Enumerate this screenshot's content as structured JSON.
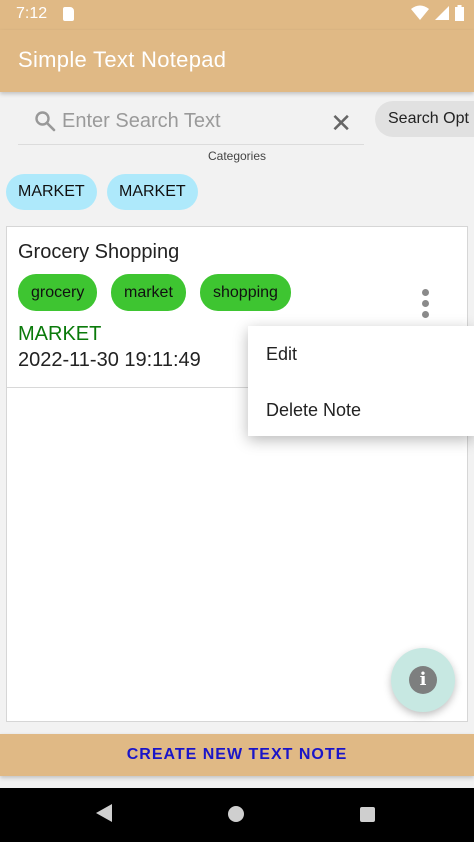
{
  "status_bar": {
    "time": "7:12"
  },
  "app_bar": {
    "title": "Simple Text Notepad"
  },
  "search": {
    "placeholder": "Enter Search Text",
    "options_label": "Search Opt"
  },
  "categories": {
    "label": "Categories",
    "chips": [
      "MARKET",
      "MARKET"
    ]
  },
  "note": {
    "title": "Grocery Shopping",
    "tags": [
      "grocery",
      "market",
      "shopping"
    ],
    "category": "MARKET",
    "date": "2022-11-30 19:11:49"
  },
  "context_menu": {
    "items": [
      "Edit",
      "Delete Note"
    ]
  },
  "create_button": {
    "label": "CREATE NEW TEXT NOTE"
  },
  "colors": {
    "app_bar": "#e0b985",
    "category_chip": "#aee9fb",
    "tag_chip": "#3ec531",
    "category_text": "#0a7a0a",
    "create_text": "#1a15c8"
  }
}
